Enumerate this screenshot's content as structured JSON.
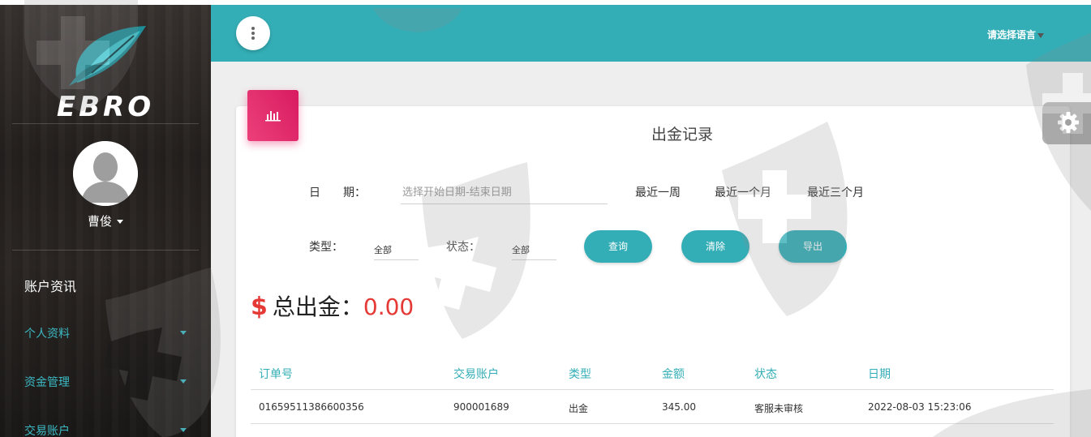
{
  "brand": {
    "logo_text": "EBRO",
    "icon": "ebro-leaf-logo-icon"
  },
  "user": {
    "name": "曹俊",
    "avatar_icon": "default-avatar-icon"
  },
  "sidebar": {
    "section_title": "账户资讯",
    "items": [
      {
        "label": "个人资料"
      },
      {
        "label": "资金管理"
      },
      {
        "label": "交易账户"
      }
    ]
  },
  "header": {
    "menu_icon": "vertical-dots-icon",
    "language_label": "请选择语言"
  },
  "page": {
    "title": "出金记录",
    "title_icon": "bar-chart-icon"
  },
  "filters": {
    "date_label": "日　　期：",
    "date_placeholder": "选择开始日期-结束日期",
    "quick_ranges": [
      "最近一周",
      "最近一个月",
      "最近三个月"
    ],
    "type_label": "类型：",
    "type_value": "全部",
    "status_label": "状态：",
    "status_value": "全部",
    "query_button": "查询",
    "clear_button": "清除",
    "export_button": "导出"
  },
  "summary": {
    "currency_symbol": "$",
    "label": "总出金：",
    "amount": "0.00"
  },
  "table": {
    "columns": [
      "订单号",
      "交易账户",
      "类型",
      "金额",
      "状态",
      "日期"
    ],
    "rows": [
      [
        "01659511386600356",
        "900001689",
        "出金",
        "345.00",
        "客服未审核",
        "2022-08-03 15:23:06"
      ]
    ]
  },
  "colors": {
    "teal": "#34aeb6",
    "pink": "#e91e63",
    "red": "#e53935",
    "sidebar_link": "#3bb9c4"
  },
  "settings_icon": "gear-icon"
}
